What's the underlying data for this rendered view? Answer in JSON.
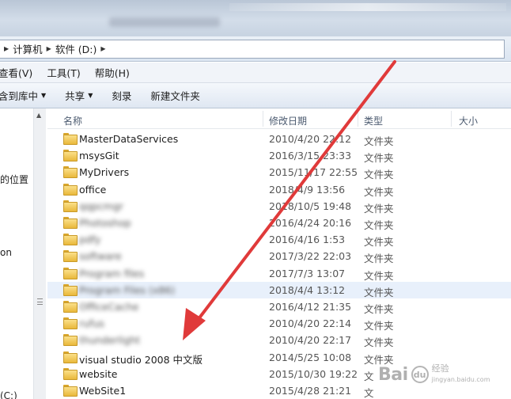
{
  "address": {
    "crumbs": [
      "计算机",
      "软件 (D:)"
    ]
  },
  "menu": [
    "查看(V)",
    "工具(T)",
    "帮助(H)"
  ],
  "toolbar": {
    "include_library": "含到库中",
    "share": "共享",
    "burn": "刻录",
    "new_folder": "新建文件夹"
  },
  "nav": {
    "item_position": "的位置",
    "item_on": "on",
    "item_drive": "(C:)"
  },
  "columns": {
    "name": "名称",
    "date": "修改日期",
    "type": "类型",
    "size": "大小"
  },
  "files": [
    {
      "name": "MasterDataServices",
      "date": "2010/4/20 22:12",
      "type": "文件夹",
      "blurred": false
    },
    {
      "name": "msysGit",
      "date": "2016/3/15 23:33",
      "type": "文件夹",
      "blurred": false
    },
    {
      "name": "MyDrivers",
      "date": "2015/11/17 22:55",
      "type": "文件夹",
      "blurred": false
    },
    {
      "name": "office",
      "date": "2018/4/9 13:56",
      "type": "文件夹",
      "blurred": false
    },
    {
      "name": "qqpcmgr",
      "date": "2018/10/5 19:48",
      "type": "文件夹",
      "blurred": true
    },
    {
      "name": "Photoshop",
      "date": "2016/4/24 20:16",
      "type": "文件夹",
      "blurred": true
    },
    {
      "name": "pdfy",
      "date": "2016/4/16 1:53",
      "type": "文件夹",
      "blurred": true
    },
    {
      "name": "software",
      "date": "2017/3/22 22:03",
      "type": "文件夹",
      "blurred": true
    },
    {
      "name": "Program files",
      "date": "2017/7/3 13:07",
      "type": "文件夹",
      "blurred": true
    },
    {
      "name": "Program Files (x86)",
      "date": "2018/4/4 13:12",
      "type": "文件夹",
      "blurred": true
    },
    {
      "name": "OfficeCache",
      "date": "2016/4/12 21:35",
      "type": "文件夹",
      "blurred": true
    },
    {
      "name": "rufus",
      "date": "2010/4/20 22:14",
      "type": "文件夹",
      "blurred": true
    },
    {
      "name": "thunderlight",
      "date": "2010/4/20 22:17",
      "type": "文件夹",
      "blurred": true
    },
    {
      "name": "visual studio 2008 中文版",
      "date": "2014/5/25 10:08",
      "type": "文件夹",
      "blurred": false
    },
    {
      "name": "website",
      "date": "2015/10/30 19:22",
      "type": "文",
      "blurred": false
    },
    {
      "name": "WebSite1",
      "date": "2015/4/28 21:21",
      "type": "文",
      "blurred": false
    }
  ],
  "watermark": {
    "logo": "Bai",
    "paw": "du",
    "line1": "经验",
    "line2": "jingyan.baidu.com"
  },
  "colors": {
    "annotation_arrow": "#e03a3a",
    "folder": "#f3c755"
  }
}
